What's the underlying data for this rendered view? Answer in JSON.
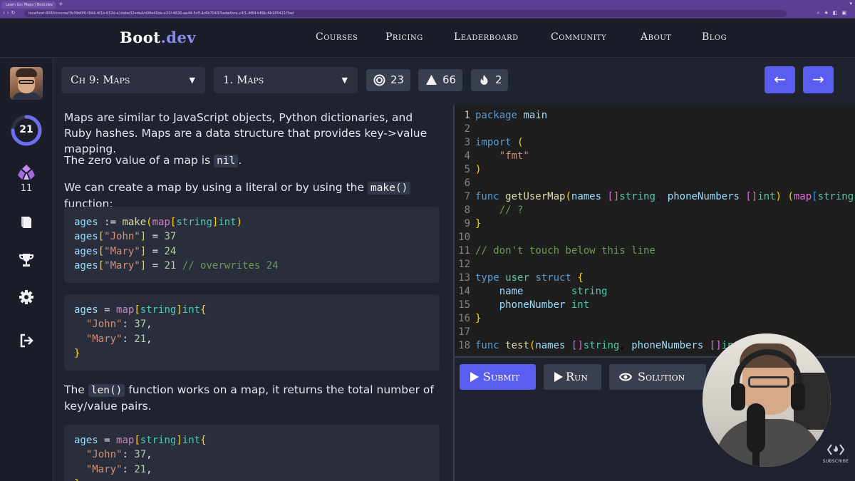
{
  "browser": {
    "tab_title": "Learn Go: Maps | Boot.dev",
    "new_tab": "+",
    "url": "localhost:8080/course/3b39d0f6-f944-4f1b-832d-e1dabe32ede4/d08e40de-e31f-4636-ae44-5cf14c6b7043/5adadbce-c4f1-4f84-b89b-6b185421f3ad"
  },
  "header": {
    "logo_main": "Boot",
    "logo_dot": ".dev",
    "nav": [
      "Courses",
      "Pricing",
      "Leaderboard",
      "Community",
      "About",
      "Blog"
    ]
  },
  "rail": {
    "level": "21",
    "level_progress": 0.75,
    "gems": "11",
    "icons": [
      "book-icon",
      "trophy-icon",
      "gear-icon",
      "logout-icon"
    ]
  },
  "toolbar": {
    "chapter": "Ch 9: Maps",
    "lesson": "1. Maps",
    "stat_target": "23",
    "stat_alert": "66",
    "stat_flame": "2",
    "prev_label": "←",
    "next_label": "→"
  },
  "lesson": {
    "p1": "Maps are similar to JavaScript objects, Python dictionaries, and Ruby hashes. Maps are a data structure that provides key->value mapping.",
    "p2_pre": "The zero value of a map is ",
    "p2_code": "nil",
    "p2_post": ".",
    "p3_pre": "We can create a map by using a literal or by using the ",
    "p3_code": "make()",
    "p3_post": " function:",
    "p4_pre": "The ",
    "p4_code": "len()",
    "p4_post": " function works on a map, it returns the total number of key/value pairs."
  },
  "editor": {
    "line_count": 18
  },
  "actions": {
    "submit": "Submit",
    "run": "Run",
    "solution": "Solution"
  },
  "overlay": {
    "subscribe": "SUBSCRIBE"
  }
}
